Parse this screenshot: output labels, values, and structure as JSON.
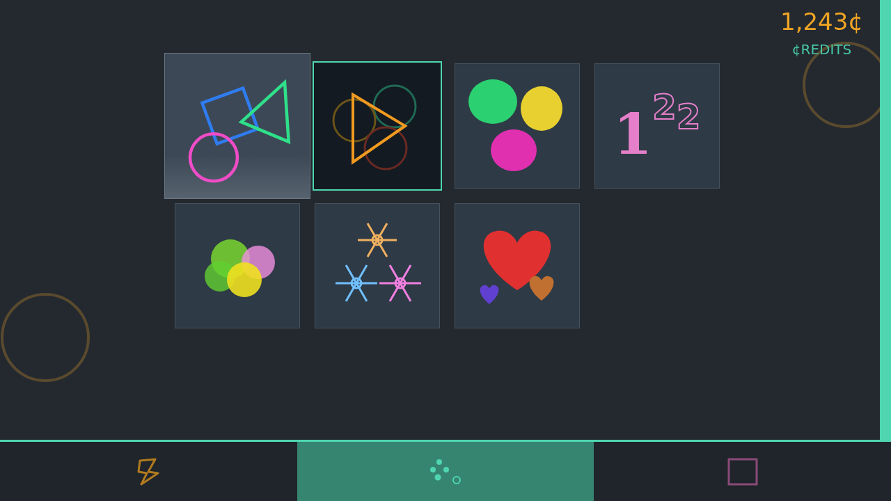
{
  "credits": {
    "amount": "1,243¢",
    "label": "¢REDITS"
  },
  "tiles": [
    {
      "kind": "shapes",
      "selected": false,
      "focused": true
    },
    {
      "kind": "play",
      "selected": true,
      "focused": false
    },
    {
      "kind": "blobs",
      "selected": false,
      "focused": false
    },
    {
      "kind": "numbers",
      "selected": false,
      "focused": false,
      "digits": [
        {
          "text": "1",
          "kind": "solid"
        },
        {
          "text": "2",
          "kind": "outline"
        },
        {
          "text": "2",
          "kind": "outline"
        }
      ]
    },
    {
      "kind": "lights",
      "selected": false,
      "focused": false
    },
    {
      "kind": "snowflakes",
      "selected": false,
      "focused": false
    },
    {
      "kind": "hearts",
      "selected": false,
      "focused": false
    }
  ],
  "tabs": [
    {
      "kind": "bolt",
      "selected": false
    },
    {
      "kind": "dots",
      "selected": true
    },
    {
      "kind": "square",
      "selected": false
    }
  ]
}
